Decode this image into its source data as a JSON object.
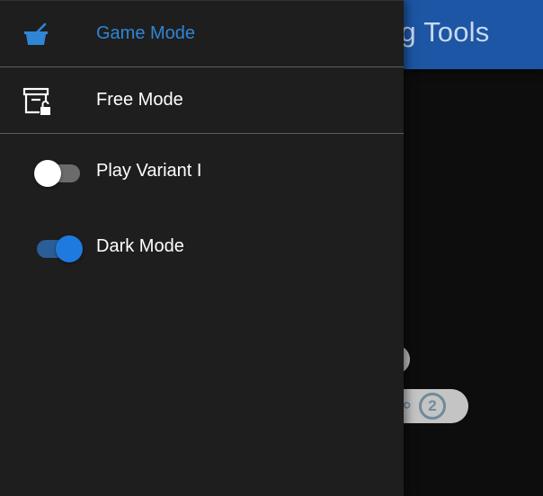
{
  "app": {
    "title": "Arg Tools"
  },
  "drawer": {
    "items": [
      {
        "label": "Game Mode",
        "icon": "pot-icon",
        "active": true
      },
      {
        "label": "Free Mode",
        "icon": "archive-unlock-icon",
        "active": false
      }
    ],
    "toggles": [
      {
        "label": "Play Variant I",
        "checked": false
      },
      {
        "label": "Dark Mode",
        "checked": true
      }
    ]
  },
  "background": {
    "chip_number": "2",
    "chip_symbol": "⚯"
  },
  "colors": {
    "accent": "#2f86d6",
    "appbar": "#1c56a4",
    "drawer_bg": "#1e1e1e",
    "page_bg": "#0d0d0d",
    "switch_on": "#1f7ae0"
  }
}
